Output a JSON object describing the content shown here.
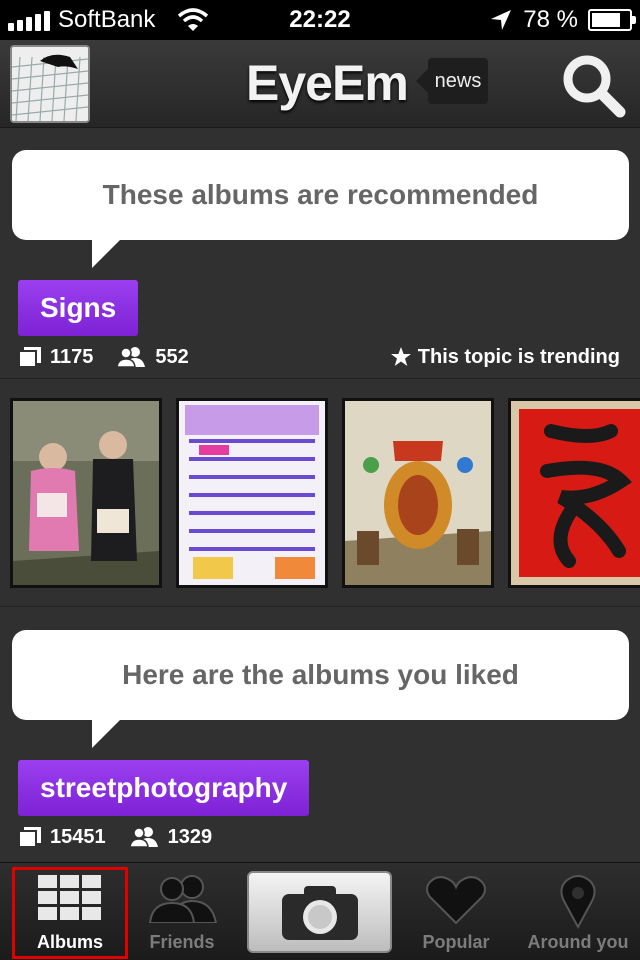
{
  "status_bar": {
    "carrier": "SoftBank",
    "time": "22:22",
    "battery_percent": "78 %",
    "battery_level": 0.78,
    "signal_bars": 5
  },
  "navbar": {
    "app_title": "EyeEm",
    "news_label": "news",
    "icons": {
      "search": "search-icon",
      "avatar": "user-avatar"
    }
  },
  "recommended": {
    "bubble_text": "These albums are recommended",
    "album_name": "Signs",
    "photo_count": "1175",
    "follower_count": "552",
    "trending_text": "This topic is trending"
  },
  "liked": {
    "bubble_text": "Here are the albums you liked",
    "album_name": "streetphotography",
    "photo_count": "15451",
    "follower_count": "1329"
  },
  "tabbar": {
    "tabs": [
      {
        "label": "Albums",
        "icon": "grid-icon",
        "active": true
      },
      {
        "label": "Friends",
        "icon": "people-icon",
        "active": false
      },
      {
        "label": "",
        "icon": "camera-icon",
        "active": false
      },
      {
        "label": "Popular",
        "icon": "heart-icon",
        "active": false
      },
      {
        "label": "Around you",
        "icon": "map-pin-icon",
        "active": false
      }
    ]
  },
  "colors": {
    "accent_purple": "#8a2be2",
    "background": "#303030",
    "highlight_red": "#e00000"
  }
}
